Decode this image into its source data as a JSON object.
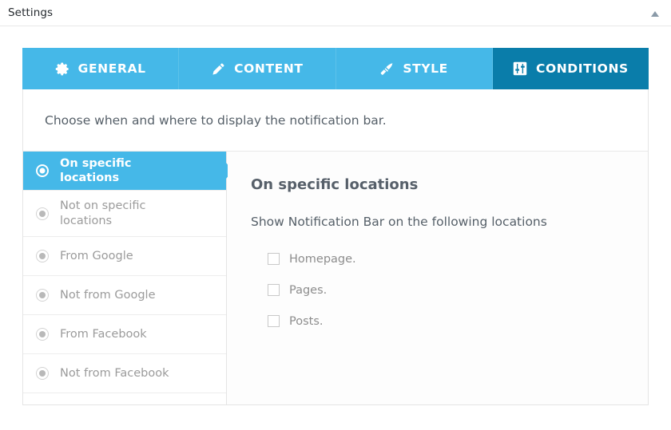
{
  "topbar": {
    "title": "Settings",
    "collapse_icon": "triangle-up-icon"
  },
  "tabs": [
    {
      "label": "GENERAL",
      "icon": "gear-icon",
      "active": false
    },
    {
      "label": "CONTENT",
      "icon": "pencil-icon",
      "active": false
    },
    {
      "label": "STYLE",
      "icon": "paintbrush-icon",
      "active": false
    },
    {
      "label": "CONDITIONS",
      "icon": "sliders-icon",
      "active": true
    }
  ],
  "description": "Choose when and where to display the notification bar.",
  "options": [
    {
      "label": "On specific locations",
      "selected": true
    },
    {
      "label": "Not on specific locations",
      "selected": false
    },
    {
      "label": "From Google",
      "selected": false
    },
    {
      "label": "Not from Google",
      "selected": false
    },
    {
      "label": "From Facebook",
      "selected": false
    },
    {
      "label": "Not from Facebook",
      "selected": false
    }
  ],
  "detail": {
    "title": "On specific locations",
    "subtitle": "Show Notification Bar on the following locations",
    "checkboxes": [
      {
        "label": "Homepage.",
        "checked": false
      },
      {
        "label": "Pages.",
        "checked": false
      },
      {
        "label": "Posts.",
        "checked": false
      }
    ]
  },
  "colors": {
    "tab_blue": "#45b8e8",
    "tab_active_blue": "#0a7daa",
    "panel_bg": "#fdfdfd",
    "border": "#e4e4e4"
  }
}
